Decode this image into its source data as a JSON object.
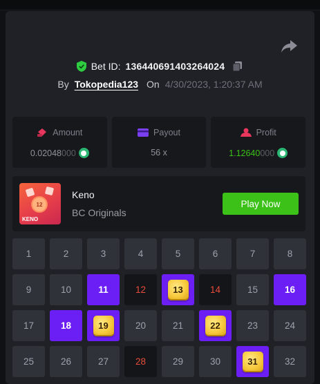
{
  "bet": {
    "label": "Bet ID:",
    "id": "136440691403264024",
    "by_label": "By",
    "username": "Tokopedia123",
    "on_label": "On",
    "datetime": "4/30/2023, 1:20:37 AM"
  },
  "stats": {
    "amount": {
      "label": "Amount",
      "value_main": "0.02048",
      "value_fade": "000"
    },
    "payout": {
      "label": "Payout",
      "value": "56 x"
    },
    "profit": {
      "label": "Profit",
      "value_main": "1.12640",
      "value_fade": "000"
    }
  },
  "game": {
    "name": "Keno",
    "provider": "BC Originals",
    "play_label": "Play Now",
    "thumb_ball": "12",
    "thumb_title": "KENO"
  },
  "colors": {
    "accent_green": "#3bc117",
    "selected_purple": "#6c1ff5",
    "miss_red": "#e74c3c",
    "panel": "#1f2126"
  },
  "keno_board": {
    "cells": [
      {
        "n": "1",
        "state": "default"
      },
      {
        "n": "2",
        "state": "default"
      },
      {
        "n": "3",
        "state": "default"
      },
      {
        "n": "4",
        "state": "default"
      },
      {
        "n": "5",
        "state": "default"
      },
      {
        "n": "6",
        "state": "default"
      },
      {
        "n": "7",
        "state": "default"
      },
      {
        "n": "8",
        "state": "default"
      },
      {
        "n": "9",
        "state": "default"
      },
      {
        "n": "10",
        "state": "default"
      },
      {
        "n": "11",
        "state": "selected"
      },
      {
        "n": "12",
        "state": "miss"
      },
      {
        "n": "13",
        "state": "hit"
      },
      {
        "n": "14",
        "state": "miss"
      },
      {
        "n": "15",
        "state": "default"
      },
      {
        "n": "16",
        "state": "selected"
      },
      {
        "n": "17",
        "state": "default"
      },
      {
        "n": "18",
        "state": "selected"
      },
      {
        "n": "19",
        "state": "hit"
      },
      {
        "n": "20",
        "state": "default"
      },
      {
        "n": "21",
        "state": "default"
      },
      {
        "n": "22",
        "state": "hit"
      },
      {
        "n": "23",
        "state": "default"
      },
      {
        "n": "24",
        "state": "default"
      },
      {
        "n": "25",
        "state": "default"
      },
      {
        "n": "26",
        "state": "default"
      },
      {
        "n": "27",
        "state": "default"
      },
      {
        "n": "28",
        "state": "miss"
      },
      {
        "n": "29",
        "state": "default"
      },
      {
        "n": "30",
        "state": "default"
      },
      {
        "n": "31",
        "state": "hit"
      },
      {
        "n": "32",
        "state": "default"
      }
    ]
  }
}
